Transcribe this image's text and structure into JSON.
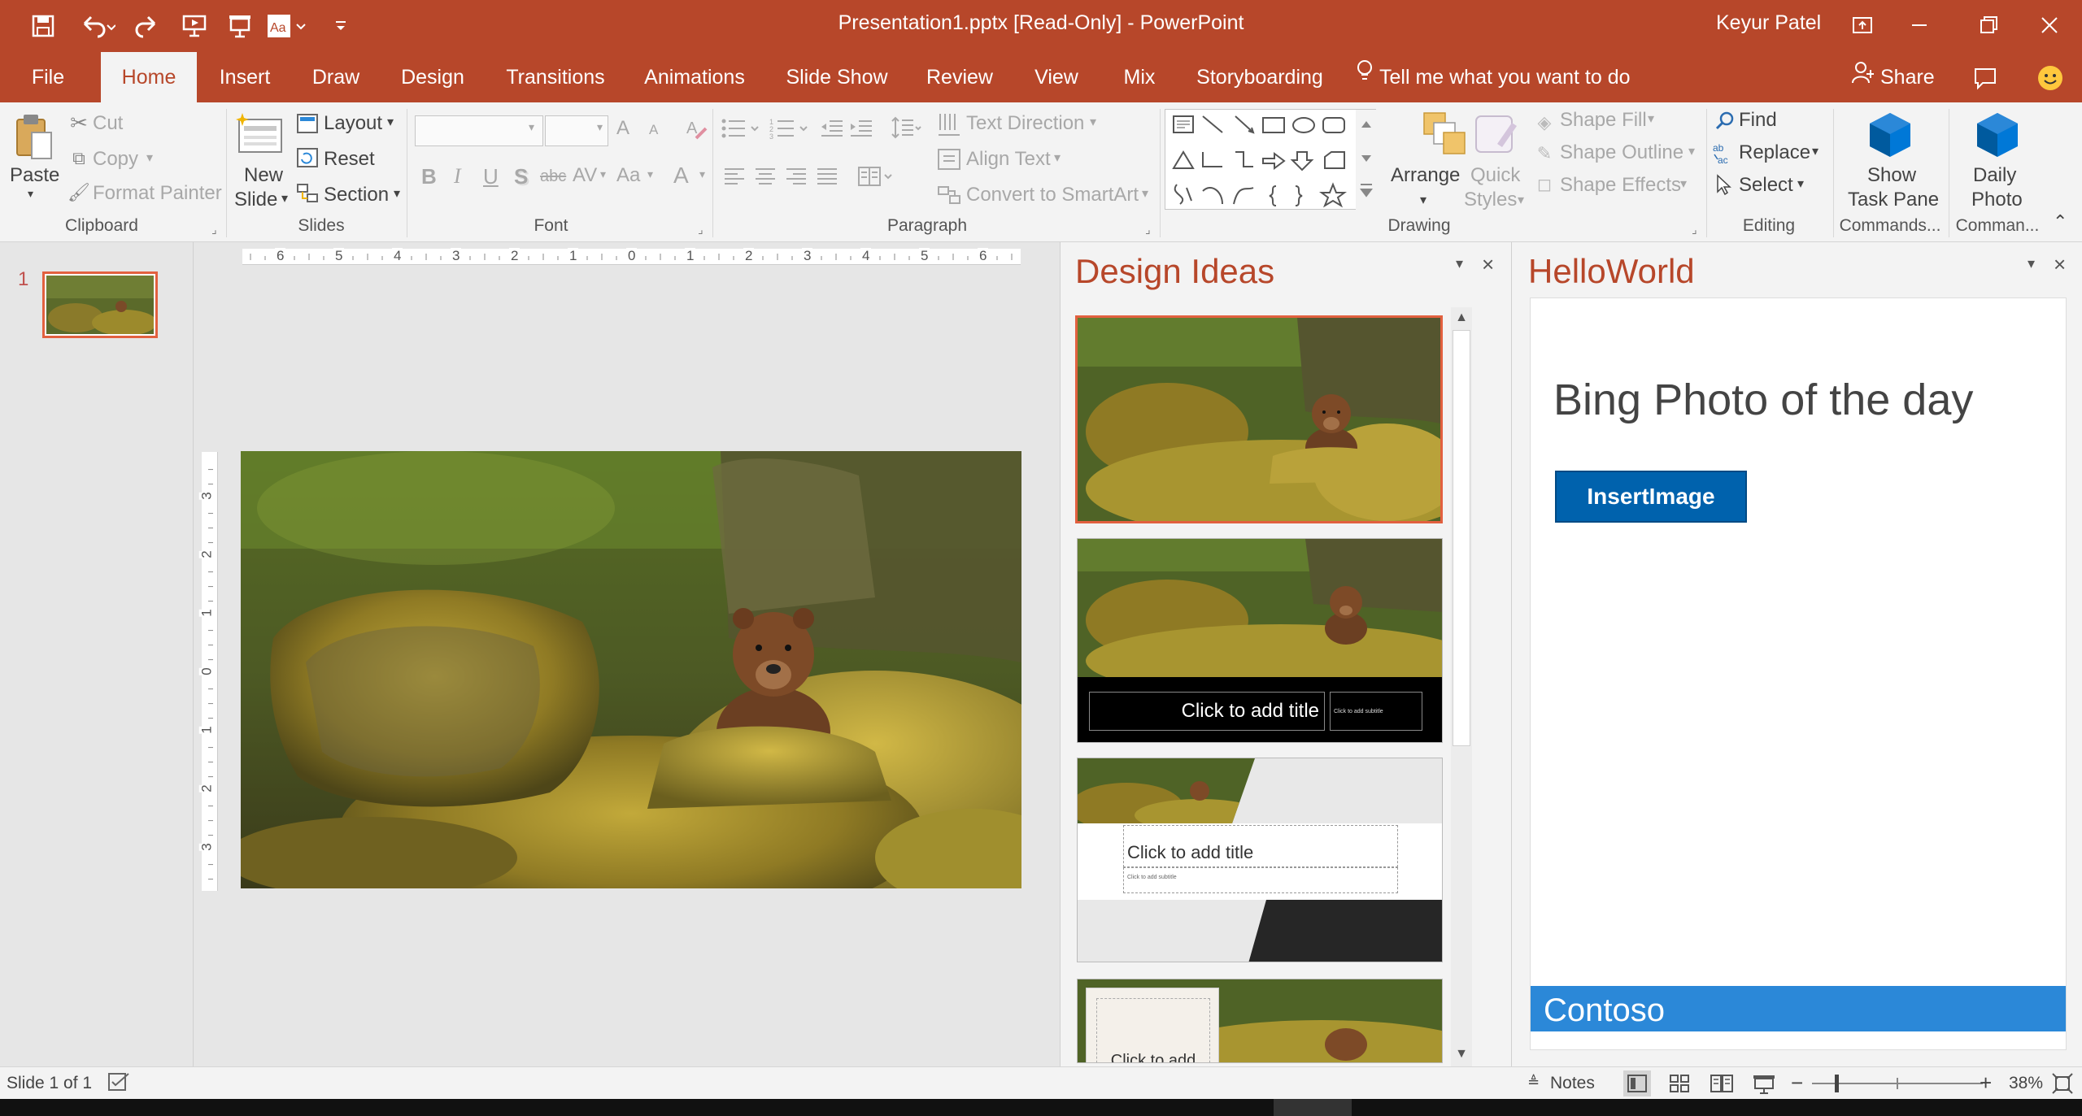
{
  "titlebar": {
    "document_title": "Presentation1.pptx [Read-Only] - PowerPoint",
    "user": "Keyur Patel",
    "qat_icons": [
      "save-icon",
      "undo-icon",
      "redo-icon",
      "start-from-beginning-icon",
      "present-icon",
      "font-icon",
      "customize-icon"
    ]
  },
  "tabs": [
    {
      "label": "File"
    },
    {
      "label": "Home"
    },
    {
      "label": "Insert"
    },
    {
      "label": "Draw"
    },
    {
      "label": "Design"
    },
    {
      "label": "Transitions"
    },
    {
      "label": "Animations"
    },
    {
      "label": "Slide Show"
    },
    {
      "label": "Review"
    },
    {
      "label": "View"
    },
    {
      "label": "Mix"
    },
    {
      "label": "Storyboarding"
    }
  ],
  "tell_me": "Tell me what you want to do",
  "share": "Share",
  "ribbon": {
    "clipboard": {
      "paste": "Paste",
      "cut": "Cut",
      "copy": "Copy",
      "format_painter": "Format Painter",
      "group": "Clipboard"
    },
    "slides": {
      "new_slide_1": "New",
      "new_slide_2": "Slide",
      "layout": "Layout",
      "reset": "Reset",
      "section": "Section",
      "group": "Slides"
    },
    "font": {
      "bold": "B",
      "italic": "I",
      "underline": "U",
      "shadow": "S",
      "strike": "abc",
      "spacing": "AV",
      "case": "Aa",
      "color": "A",
      "grow": "A",
      "shrink": "A",
      "group": "Font"
    },
    "paragraph": {
      "text_direction": "Text Direction",
      "align_text": "Align Text",
      "convert_smartart": "Convert to SmartArt",
      "group": "Paragraph"
    },
    "drawing": {
      "arrange": "Arrange",
      "quick_styles_1": "Quick",
      "quick_styles_2": "Styles",
      "shape_fill": "Shape Fill",
      "shape_outline": "Shape Outline",
      "shape_effects": "Shape Effects",
      "group": "Drawing"
    },
    "editing": {
      "find": "Find",
      "replace": "Replace",
      "select": "Select",
      "group": "Editing"
    },
    "commands": {
      "show_1": "Show",
      "show_2": "Task Pane",
      "group": "Commands..."
    },
    "daily": {
      "daily_1": "Daily",
      "daily_2": "Photo",
      "group": "Comman..."
    }
  },
  "thumbnails": [
    {
      "number": "1"
    }
  ],
  "ruler": {
    "h_labels": [
      "6",
      "5",
      "4",
      "3",
      "2",
      "1",
      "0",
      "1",
      "2",
      "3",
      "4",
      "5",
      "6"
    ],
    "v_labels": [
      "3",
      "2",
      "1",
      "0",
      "1",
      "2",
      "3"
    ]
  },
  "design_ideas": {
    "title": "Design Ideas",
    "idea2_title": "Click to add title",
    "idea2_subtitle": "Click to add subtitle",
    "idea3_title": "Click to add title",
    "idea3_subtitle": "Click to add subtitle",
    "idea4_title": "Click to add"
  },
  "helloworld": {
    "title": "HelloWorld",
    "heading": "Bing Photo of the day",
    "button": "InsertImage",
    "footer": "Contoso"
  },
  "status": {
    "slide": "Slide 1 of 1",
    "notes": "Notes",
    "zoom": "38%"
  },
  "colors": {
    "accent": "#b7472a",
    "office_blue": "#0062ad",
    "contoso_bar": "#2b88d8"
  }
}
